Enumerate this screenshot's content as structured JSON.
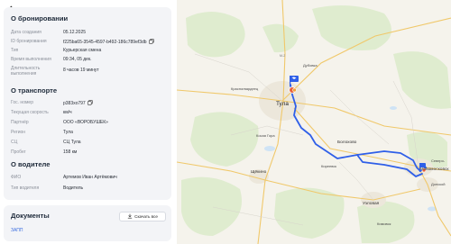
{
  "booking": {
    "title": "О бронировании",
    "rows": [
      {
        "label": "Дата создания",
        "value": "05.12.2025"
      },
      {
        "label": "ID бронирования",
        "value": "f225ba65-3545-4597-b492-186c789ef3db"
      },
      {
        "label": "Тип",
        "value": "Курьерская смена"
      },
      {
        "label": "Время выполнения",
        "value": "09:34, 05 дек."
      },
      {
        "label": "Длительность выполнения",
        "value": "8 часов 19 минут"
      }
    ]
  },
  "transport": {
    "title": "О транспорте",
    "rows": [
      {
        "label": "Гос. номер",
        "value": "р383хо797"
      },
      {
        "label": "Текущая скорость",
        "value": "км/ч"
      },
      {
        "label": "Партнёр",
        "value": "ООО «ВОРОБУШЕК»"
      },
      {
        "label": "Регион",
        "value": "Тула"
      },
      {
        "label": "СЦ",
        "value": "СЦ Тула"
      },
      {
        "label": "Пробег",
        "value": "158 км"
      }
    ]
  },
  "driver": {
    "title": "О водителе",
    "rows": [
      {
        "label": "ФИО",
        "value": "Артемов Иван Артёмович"
      },
      {
        "label": "Тип водителя",
        "value": "Водитель"
      }
    ]
  },
  "documents": {
    "title": "Документы",
    "download_label": "Скачать все",
    "link_label": "ЗАПП"
  },
  "map": {
    "labels": {
      "tula": "Тула",
      "krasnogvardeets": "Красногвардеец",
      "kosaya_gora": "Косая Гора",
      "bolokhovo": "Болохово",
      "uzlovaya": "Узловая",
      "novomoskovsk": "Новомосковск",
      "donskoy": "Донской",
      "shchekino": "Щёкино",
      "kireevsk": "Киреевск",
      "severo": "Северо-",
      "kimovsk": "Кимовск",
      "dubovka": "Дубовка",
      "plavsk_road": "М-2"
    },
    "route_color": "#2f5fe8",
    "marker_color": "#2f5fe8"
  },
  "colors": {
    "accent": "#3d6fe0",
    "card_bg": "#f3f4f7",
    "map_bg": "#f5f3ec"
  }
}
